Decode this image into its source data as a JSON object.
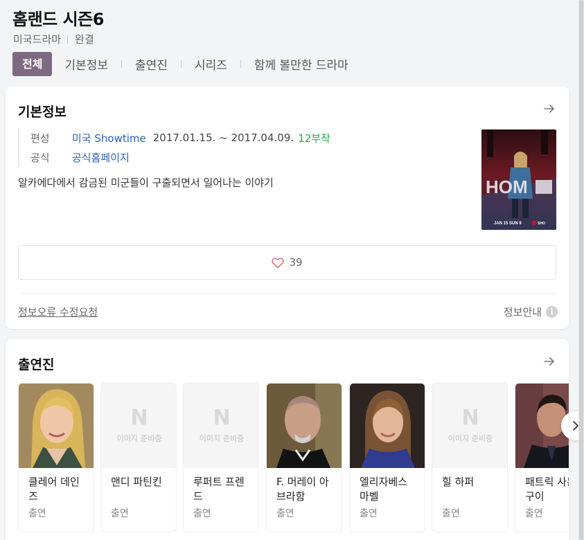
{
  "header": {
    "title": "홈랜드 시즌6",
    "genre": "미국드라마",
    "status": "완결"
  },
  "tabs": [
    {
      "label": "전체",
      "active": true
    },
    {
      "label": "기본정보"
    },
    {
      "label": "출연진"
    },
    {
      "label": "시리즈"
    },
    {
      "label": "함께 볼만한 드라마"
    }
  ],
  "basic_info": {
    "title": "기본정보",
    "broadcast_label": "편성",
    "broadcast_channel": "미국 Showtime",
    "broadcast_dates": "2017.01.15. ~ 2017.04.09.",
    "episodes": "12부작",
    "official_label": "공식",
    "official_link": "공식홈페이지",
    "synopsis": "알카에다에서 감금된 미군들이 구출되면서 일어나는 이야기",
    "like_count": "39",
    "report_link": "정보오류 수정요청",
    "info_guide": "정보안내",
    "info_icon": "i"
  },
  "cast": {
    "title": "출연진",
    "placeholder_mark": "N",
    "placeholder_text": "이미지 준비중",
    "members": [
      {
        "name": "클레어 데인즈",
        "role": "출연",
        "photo": "real"
      },
      {
        "name": "맨디 파틴킨",
        "role": "출연",
        "photo": "placeholder"
      },
      {
        "name": "루퍼트 프렌드",
        "role": "출연",
        "photo": "placeholder"
      },
      {
        "name": "F. 머레이 아브라함",
        "role": "출연",
        "photo": "real"
      },
      {
        "name": "엘리자베스 마벨",
        "role": "출연",
        "photo": "real"
      },
      {
        "name": "힐 하퍼",
        "role": "출연",
        "photo": "placeholder"
      },
      {
        "name": "패트릭 사본구이",
        "role": "출연",
        "photo": "real"
      }
    ]
  },
  "colors": {
    "accent_tab": "#7d6a82",
    "link_blue": "#2b5fb4",
    "episodes_green": "#2aa64b"
  }
}
